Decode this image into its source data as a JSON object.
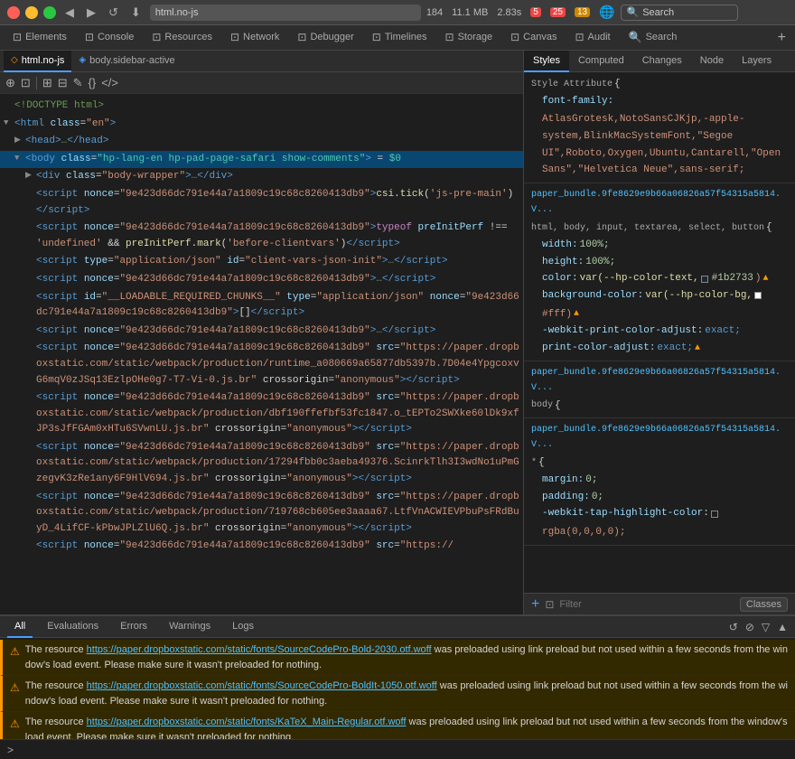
{
  "browser": {
    "window_controls": {
      "close_label": "close",
      "min_label": "minimize",
      "max_label": "maximize"
    },
    "nav": {
      "back": "◀",
      "forward": "▶",
      "refresh": "↺",
      "down": "⬇"
    },
    "url": "html.no-js",
    "counts": {
      "resources": "184",
      "memory": "11.1 MB",
      "time": "2.83s",
      "errors": "5",
      "warnings_red": "25",
      "warnings_yellow": "13"
    },
    "search_placeholder": "Search"
  },
  "devtools_tabs": [
    {
      "label": "Elements",
      "icon": "⊡",
      "active": false
    },
    {
      "label": "Console",
      "icon": "⊡",
      "active": false
    },
    {
      "label": "Resources",
      "icon": "⊡",
      "active": false
    },
    {
      "label": "Network",
      "icon": "⊡",
      "active": false
    },
    {
      "label": "Debugger",
      "icon": "⊡",
      "active": false
    },
    {
      "label": "Timelines",
      "icon": "⊡",
      "active": false
    },
    {
      "label": "Storage",
      "icon": "⊡",
      "active": false
    },
    {
      "label": "Canvas",
      "icon": "⊡",
      "active": false
    },
    {
      "label": "Audit",
      "icon": "⊡",
      "active": false
    },
    {
      "label": "Search",
      "icon": "⊡",
      "active": false
    }
  ],
  "file_tabs": [
    {
      "label": "html.no-js",
      "icon": "◇",
      "active": true
    },
    {
      "label": "body.sidebar-active",
      "icon": "◈",
      "active": false
    }
  ],
  "dom_tree": [
    {
      "indent": 0,
      "arrow": "",
      "content": "<!DOCTYPE html>"
    },
    {
      "indent": 0,
      "arrow": "▼",
      "content_html": "<span class='tag-open'>&lt;html</span> <span class='attr-name'>class</span>=<span class='attr-value'>\"en\"</span><span class='tag-open'>&gt;</span>"
    },
    {
      "indent": 1,
      "arrow": "▶",
      "content_html": "<span class='tag-open'>&lt;head&gt;</span><span class='tag-open'>…</span><span class='tag-close'>&lt;/head&gt;</span>"
    },
    {
      "indent": 1,
      "arrow": "▼",
      "content_html": "<span class='tag-open'>&lt;body</span> <span class='attr-name'>class</span>=<span class='attr-value-blue'>\"hp-lang-en hp-pad-page-safari show-comments\"</span><span class='tag-open'>&gt;</span> <span class='equals'>= <span class='dollar-sign'>$0</span></span>"
    },
    {
      "indent": 2,
      "arrow": "▶",
      "content_html": "<span class='tag-open'>&lt;div</span> <span class='attr-name'>class</span>=<span class='attr-value'>\"body-wrapper\"</span><span class='tag-open'>&gt;</span><span class='tag-close'>…</span><span class='tag-close'>&lt;/div&gt;</span>"
    },
    {
      "indent": 2,
      "arrow": "",
      "content_html": "<span class='tag-open'>&lt;script</span> <span class='attr-name'>nonce</span>=<span class='attr-value'>\"9e423d66dc791e44a7a1809c19c68c8260413db9\"</span><span class='tag-open'>&gt;</span><span class='js-func'>csi</span>.<span class='js-func'>tick</span>(<span class='js-string'>'js-pre-main'</span>)<span class='tag-close'>&lt;/script&gt;</span>"
    },
    {
      "indent": 2,
      "arrow": "",
      "content_html": "<span class='tag-open'>&lt;script</span> <span class='attr-name'>nonce</span>=<span class='attr-value'>\"9e423d66dc791e44a7a1809c19c68c8260413db9\"</span><span class='tag-open'>&gt;</span><span class='js-keyword'>typeof</span> <span class='js-var'>preInitPerf</span> !== <span class='js-string'>'undefined'</span> &amp;&amp; <span class='js-func'>preInitPerf</span>.<span class='js-func'>mark</span>(<span class='js-string'>'before-clientvars'</span>)<span class='tag-close'>&lt;/script&gt;</span>"
    },
    {
      "indent": 2,
      "arrow": "",
      "content_html": "<span class='tag-open'>&lt;script</span> <span class='attr-name'>type</span>=<span class='attr-value'>\"application/json\"</span> <span class='attr-name'>id</span>=<span class='attr-value'>\"client-vars-json-init\"</span><span class='tag-open'>&gt;</span><span class='tag-close'>…</span><span class='tag-close'>&lt;/script&gt;</span>"
    },
    {
      "indent": 2,
      "arrow": "",
      "content_html": "<span class='tag-open'>&lt;script</span> <span class='attr-name'>nonce</span>=<span class='attr-value'>\"9e423d66dc791e44a7a1809c19c68c8260413db9\"</span><span class='tag-open'>&gt;</span><span class='tag-close'>…</span><span class='tag-close'>&lt;/script&gt;</span>"
    },
    {
      "indent": 2,
      "arrow": "",
      "content_html": "<span class='tag-open'>&lt;script</span> <span class='attr-name'>id</span>=<span class='attr-value'>\"__LOADABLE_REQUIRED_CHUNKS__\"</span> <span class='attr-name'>type</span>=<span class='attr-value'>\"application/json\"</span> <span class='attr-name'>nonce</span>=<span class='attr-value'>\"9e423d66dc791e44a7a1809c19c68c8260413db9\"</span><span class='tag-open'>&gt;</span><span class='js-text'>[]</span><span class='tag-close'>&lt;/script&gt;</span>"
    },
    {
      "indent": 2,
      "arrow": "",
      "content_html": "<span class='tag-open'>&lt;script</span> <span class='attr-name'>nonce</span>=<span class='attr-value'>\"9e423d66dc791e44a7a1809c19c68c8260413db9\"</span><span class='tag-open'>&gt;</span><span class='tag-close'>…</span><span class='tag-close'>&lt;/script&gt;</span>"
    },
    {
      "indent": 2,
      "arrow": "",
      "content_html": "<span class='tag-open'>&lt;script</span> <span class='attr-name'>nonce</span>=<span class='attr-value'>\"9e423d66dc791e44a7a1809c19c68c8260413db9\"</span> <span class='attr-name'>src</span>=<span class='attr-value'>\"https://paper.dropboxstatic.com/static/webpack/production/runtime_a080669a65877db5397b.7D04e4YpgcoxvG6mqV0zJSq13EzlpOHe0g7-T7-Vi-0.js.br\"</span> <span class='attr-name'>crossorigin</span>=<span class='attr-value'>\"anonymous\"</span><span class='tag-close'>&gt;&lt;/script&gt;</span>"
    },
    {
      "indent": 2,
      "arrow": "",
      "content_html": "<span class='tag-open'>&lt;script</span> <span class='attr-name'>nonce</span>=<span class='attr-value'>\"9e423d66dc791e44a7a1809c19c68c8260413db9\"</span> <span class='attr-name'>src</span>=<span class='attr-value'>\"https://paper.dropboxstatic.com/static/webpack/production/dbf190ffefbf53fc1847.o_tEPTo2SWXke60lDk9xfJP3sJfFGAm0xHTu6SVwnLU.js.br\"</span> <span class='attr-name'>crossorigin</span>=<span class='attr-value'>\"anonymous\"</span><span class='tag-close'>&gt;&lt;/script&gt;</span>"
    },
    {
      "indent": 2,
      "arrow": "",
      "content_html": "<span class='tag-open'>&lt;script</span> <span class='attr-name'>nonce</span>=<span class='attr-value'>\"9e423d66dc791e44a7a1809c19c68c8260413db9\"</span> <span class='attr-name'>src</span>=<span class='attr-value'>\"https://paper.dropboxstatic.com/static/webpack/production/17294fbb0c3aeba49376.ScinrkTlh3I3wdNo1uPmGzegvK3zRe1any6F9HlV694.js.br\"</span> <span class='attr-name'>crossorigin</span>=<span class='attr-value'>\"anonymous\"</span><span class='tag-close'>&gt;&lt;/script&gt;</span>"
    },
    {
      "indent": 2,
      "arrow": "",
      "content_html": "<span class='tag-open'>&lt;script</span> <span class='attr-name'>nonce</span>=<span class='attr-value'>\"9e423d66dc791e44a7a1809c19c68c8260413db9\"</span> <span class='attr-name'>src</span>=<span class='attr-value'>\"https://paper.dropboxstatic.com/static/webpack/production/719768cb605ee3aaaa67.LtfVnACWIEVPbuPsFRdBuyD_4LifCF-kPbwJPLZlU6Q.js.br\"</span> <span class='attr-name'>crossorigin</span>=<span class='attr-value'>\"anonymous\"</span><span class='tag-close'>&gt;&lt;/script&gt;</span>"
    },
    {
      "indent": 2,
      "arrow": "",
      "content_html": "<span class='tag-open'>&lt;script</span> <span class='attr-name'>nonce</span>=<span class='attr-value'>\"9e423d66dc791e44a7a1809c19c68c8260413db9\"</span> <span class='attr-name'>src</span>=<span class='attr-value'>\"https://</span>"
    }
  ],
  "styles_tabs": [
    "Styles",
    "Computed",
    "Changes",
    "Node",
    "Layers"
  ],
  "active_styles_tab": "Styles",
  "style_sections": [
    {
      "source": "Style Attribute",
      "brace_open": "{",
      "rules": [
        {
          "prop": "font-family:",
          "val": "AtlasGrotesk,NotoSansCJKjp,-apple-system,BlinkMacSystemFont,\"Segoe UI\",Roboto,Oxygen,Ubuntu,Cantarell,\"Open Sans\",\"Helvetica Neue\",sans-serif;"
        }
      ]
    },
    {
      "source": "paper_bundle.9fe8629e9b66a06826a57f54315a5814.V...",
      "selector": "html, body, input, textarea, select, button",
      "brace_open": "{",
      "rules": [
        {
          "prop": "width:",
          "val": "100%;",
          "warn": false
        },
        {
          "prop": "height:",
          "val": "100%;",
          "warn": false
        },
        {
          "prop": "color:",
          "val": "var(--hp-color-text,",
          "val2": "#1b2733",
          "swatch": "#1b2733",
          "warn": true
        },
        {
          "prop": "background-color:",
          "val": "var(--hp-color-bg,",
          "swatch2": "#fff",
          "warn": true
        },
        {
          "prop": "-webkit-print-color-adjust:",
          "val": "exact;",
          "warn": false
        },
        {
          "prop": "print-color-adjust:",
          "val": "exact;",
          "warn": true
        }
      ]
    },
    {
      "source": "paper_bundle.9fe8629e9b66a06826a57f54315a5814.V...",
      "selector": "body",
      "brace_open": "{",
      "rules": []
    },
    {
      "source": "paper_bundle.9fe8629e9b66a06826a57f54315a5814.V...",
      "selector": "*",
      "brace_open": "{",
      "rules": [
        {
          "prop": "margin:",
          "val": "0;"
        },
        {
          "prop": "padding:",
          "val": "0;"
        },
        {
          "prop": "-webkit-tap-highlight-color:",
          "val": "rgba(0,0,0,0);",
          "swatch": "rgba(0,0,0,0)"
        }
      ]
    }
  ],
  "filter_bar": {
    "placeholder": "Filter",
    "classes_label": "Classes"
  },
  "console": {
    "tabs": [
      "All",
      "Evaluations",
      "Errors",
      "Warnings",
      "Logs"
    ],
    "active_tab": "All",
    "messages": [
      {
        "type": "warning",
        "text_before": "The resource ",
        "link": "https://paper.dropboxstatic.com/static/fonts/SourceCodePro-Bold-2030.otf.woff",
        "text_after": " was preloaded using link preload but not used within a few seconds from the window's load event. Please make sure it wasn't preloaded for nothing."
      },
      {
        "type": "warning",
        "text_before": "The resource ",
        "link": "https://paper.dropboxstatic.com/static/fonts/SourceCodePro-BoldIt-1050.otf.woff",
        "text_after": " was preloaded using link preload but not used within a few seconds from the window's load event. Please make sure it wasn't preloaded for nothing."
      },
      {
        "type": "warning",
        "text_before": "The resource ",
        "link": "https://paper.dropboxstatic.com/static/fonts/KaTeX_Main-Regular.otf.woff",
        "text_after": " was preloaded using link preload but not used within a few seconds from the window's load event. Please make sure it wasn't preloaded for nothing."
      }
    ],
    "input_prompt": ">",
    "action_icons": [
      "⊙",
      "⊘",
      "▽",
      "▲"
    ]
  },
  "colors": {
    "accent": "#4a9eff",
    "warning": "#f90",
    "error": "#e44",
    "swatch_dark": "#1b2733",
    "swatch_light": "#fff"
  }
}
